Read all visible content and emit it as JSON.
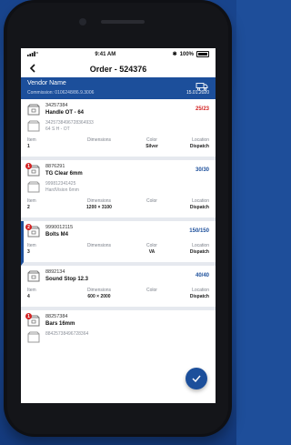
{
  "status": {
    "time": "9:41 AM",
    "battery": "100%"
  },
  "nav": {
    "title": "Order - 524376"
  },
  "vendor": {
    "name": "Vendor Name",
    "commission": "Commission: 0106248/86.9.3006",
    "date": "15.01.2020"
  },
  "columns": {
    "item": "Item",
    "dimensions": "Dimensions",
    "color": "Color",
    "location": "Location"
  },
  "items": [
    {
      "badge": "",
      "code": "34257384",
      "name": "Handle OT - 64",
      "qty": "25/23",
      "sub1": "3425738496728364933",
      "sub2": "64 S H - OT",
      "index": "1",
      "dimensions": "",
      "color": "Silver",
      "location": "Dispatch"
    },
    {
      "badge": "1",
      "code": "8876291",
      "name": "TG Clear 6mm",
      "qty": "30/30",
      "sub1": "999812341425",
      "sub2": "HardVision 6mm",
      "index": "2",
      "dimensions": "1200 × 3100",
      "color": "",
      "location": "Dispatch"
    },
    {
      "badge": "2",
      "code": "9990012115",
      "name": "Bolts M4",
      "qty": "150/150",
      "index": "3",
      "dimensions": "",
      "color": "VA",
      "location": "Dispatch"
    },
    {
      "badge": "",
      "code": "8892134",
      "name": "Sound Stop 12.3",
      "qty": "40/40",
      "index": "4",
      "dimensions": "600 × 2000",
      "color": "",
      "location": "Dispatch"
    },
    {
      "badge": "1",
      "code": "88257384",
      "name": "Bars 16mm",
      "sub1": "88425738496728364"
    }
  ],
  "colors": {
    "accent": "#1c4f9b",
    "alert": "#d32222"
  }
}
